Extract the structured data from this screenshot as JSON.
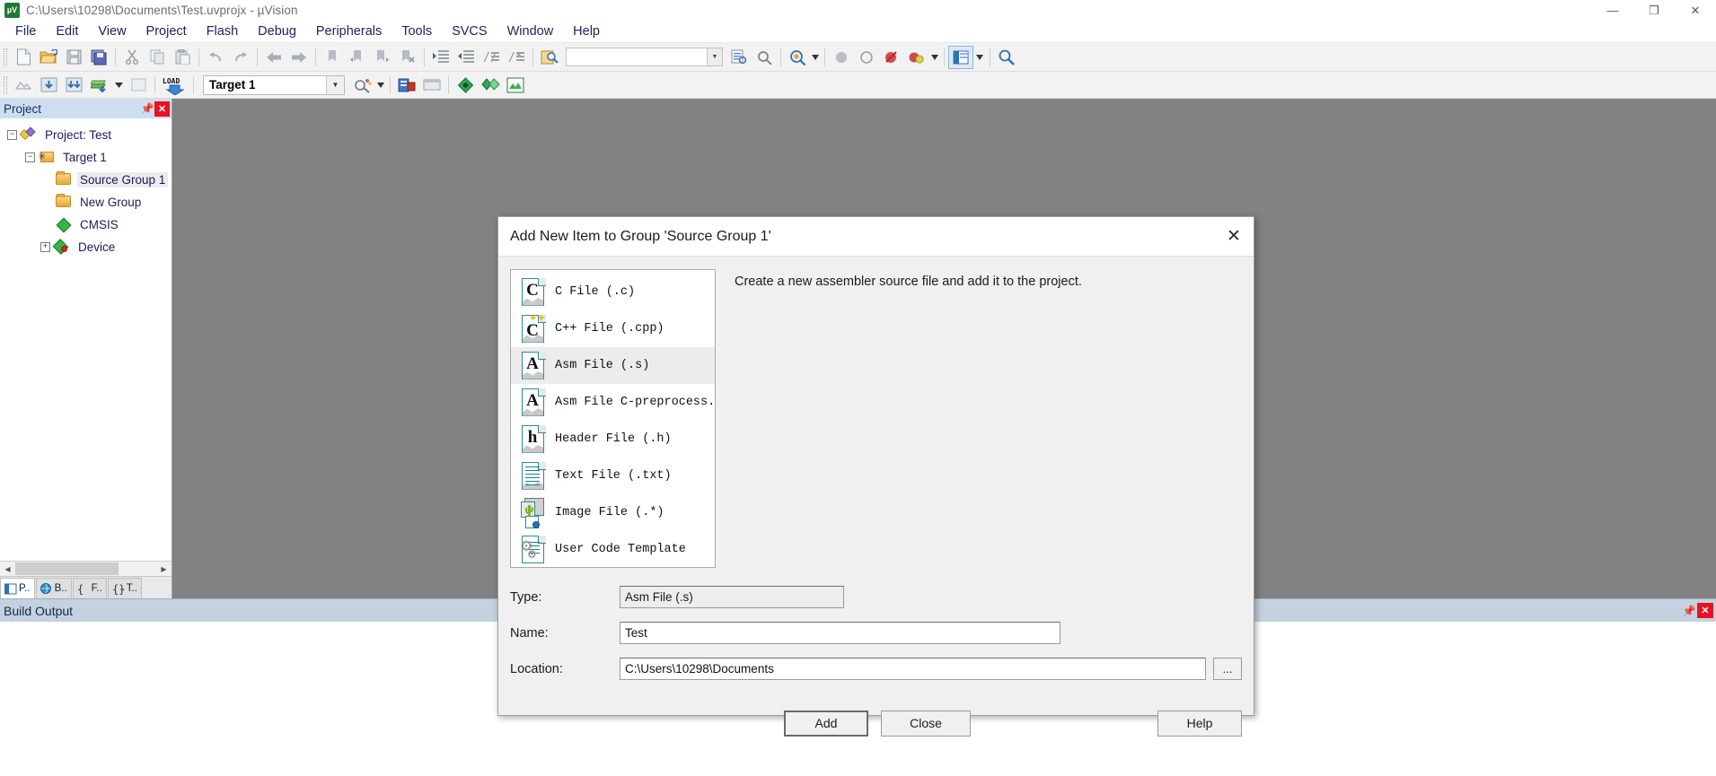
{
  "titlebar": {
    "app_icon": "uvision-logo-icon",
    "title": "C:\\Users\\10298\\Documents\\Test.uvprojx - µVision",
    "minimize": "—",
    "maximize": "❐",
    "close": "✕"
  },
  "menubar": {
    "items": [
      {
        "label": "File"
      },
      {
        "label": "Edit"
      },
      {
        "label": "View"
      },
      {
        "label": "Project"
      },
      {
        "label": "Flash"
      },
      {
        "label": "Debug"
      },
      {
        "label": "Peripherals"
      },
      {
        "label": "Tools"
      },
      {
        "label": "SVCS"
      },
      {
        "label": "Window"
      },
      {
        "label": "Help"
      }
    ]
  },
  "toolbar_main": {
    "find_box_value": "",
    "find_box_placeholder": "",
    "icons": [
      "new-file-icon",
      "open-file-icon",
      "save-icon",
      "save-all-icon",
      "cut-icon",
      "copy-icon",
      "paste-icon",
      "undo-icon",
      "redo-icon",
      "navigate-back-icon",
      "navigate-forward-icon",
      "bookmark-toggle-icon",
      "bookmark-prev-icon",
      "bookmark-next-icon",
      "bookmark-clear-icon",
      "indent-icon",
      "outdent-icon",
      "comment-icon",
      "uncomment-icon",
      "find-in-files-icon",
      "search-icon",
      "incremental-find-icon",
      "configure-magnifier-icon",
      "breakpoint-insert-icon",
      "breakpoint-disable-icon",
      "breakpoint-kill-icon",
      "breakpoint-disable-all-icon",
      "window-layout-icon",
      "configuration-wizard-icon"
    ]
  },
  "toolbar_build": {
    "target_name": "Target 1",
    "icons": [
      "translate-icon",
      "build-icon",
      "rebuild-icon",
      "batch-build-icon",
      "stop-build-icon",
      "download-icon",
      "target-options-icon",
      "manage-project-items-icon",
      "pack-installer-icon",
      "manage-runtime-env-icon",
      "multi-project-icon",
      "export-icon"
    ]
  },
  "project_pane": {
    "header_title": "Project",
    "pin_icon": "pin-icon",
    "close_icon": "close-icon",
    "tree": [
      {
        "label": "Project: Test",
        "icon": "project-icon",
        "depth": 0,
        "expander": "−",
        "selected": false
      },
      {
        "label": "Target 1",
        "icon": "target-folder-icon",
        "depth": 1,
        "expander": "−",
        "selected": false
      },
      {
        "label": "Source Group 1",
        "icon": "folder-icon",
        "depth": 2,
        "expander": "",
        "selected": true
      },
      {
        "label": "New Group",
        "icon": "folder-icon",
        "depth": 2,
        "expander": "",
        "selected": false
      },
      {
        "label": "CMSIS",
        "icon": "cmsis-icon",
        "depth": 2,
        "expander": "",
        "selected": false
      },
      {
        "label": "Device",
        "icon": "device-icon",
        "depth": 2,
        "expander": "+",
        "selected": false
      }
    ],
    "tabs": [
      {
        "label": "P..",
        "icon": "project-tab-icon",
        "selected": true
      },
      {
        "label": "B..",
        "icon": "books-tab-icon",
        "selected": false
      },
      {
        "label": "F..",
        "icon": "functions-tab-icon",
        "selected": false
      },
      {
        "label": "T..",
        "icon": "templates-tab-icon",
        "selected": false
      }
    ],
    "scroll_left_icon": "chevron-left-icon",
    "scroll_right_icon": "chevron-right-icon"
  },
  "dialog": {
    "title": "Add New Item to Group 'Source Group 1'",
    "close_icon": "✕",
    "description": "Create a new assembler source file and add it to the project.",
    "file_types": [
      {
        "label": "C File (.c)",
        "icon": "c-file-icon",
        "glyph": "C",
        "selected": false
      },
      {
        "label": "C++ File (.cpp)",
        "icon": "cpp-file-icon",
        "glyph": "C",
        "selected": false
      },
      {
        "label": "Asm File (.s)",
        "icon": "asm-file-icon",
        "glyph": "A",
        "selected": true
      },
      {
        "label": "Asm File C-preprocess...",
        "icon": "asm-preproc-file-icon",
        "glyph": "A",
        "selected": false
      },
      {
        "label": "Header File (.h)",
        "icon": "header-file-icon",
        "glyph": "h",
        "selected": false
      },
      {
        "label": "Text File (.txt)",
        "icon": "text-file-icon",
        "glyph": "",
        "selected": false
      },
      {
        "label": "Image File (.*)",
        "icon": "image-file-icon",
        "glyph": "",
        "selected": false
      },
      {
        "label": "User Code Template",
        "icon": "user-code-template-icon",
        "glyph": "",
        "selected": false
      }
    ],
    "fields": {
      "type_label": "Type:",
      "type_value": "Asm File (.s)",
      "name_label": "Name:",
      "name_value": "Test",
      "location_label": "Location:",
      "location_value": "C:\\Users\\10298\\Documents",
      "browse_label": "..."
    },
    "buttons": {
      "add": "Add",
      "close": "Close",
      "help": "Help"
    }
  },
  "build_output": {
    "title": "Build Output",
    "pin_icon": "pin-icon",
    "close_icon": "close-icon"
  }
}
